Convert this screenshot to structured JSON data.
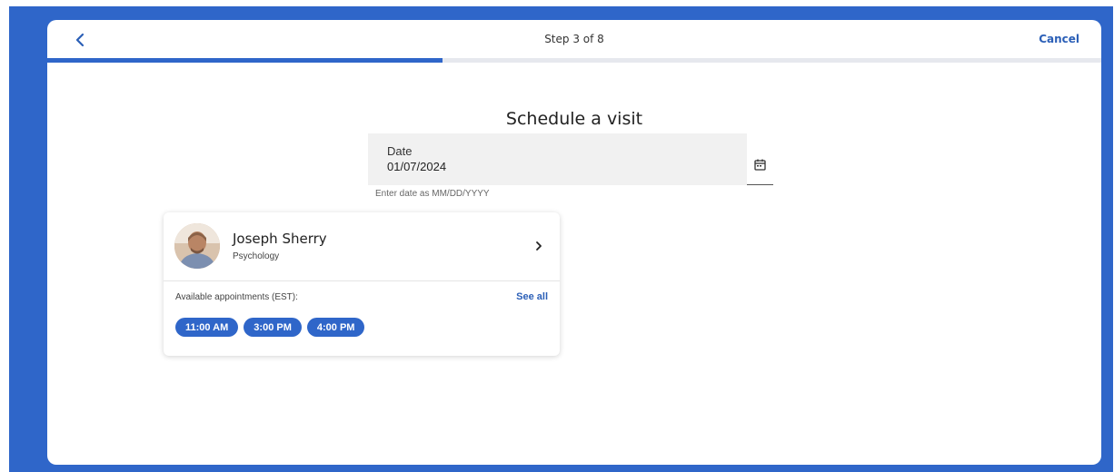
{
  "header": {
    "step_label": "Step 3 of 8",
    "cancel_label": "Cancel",
    "progress_fraction": 0.375
  },
  "page": {
    "title": "Schedule a visit"
  },
  "date_field": {
    "label": "Date",
    "value": "01/07/2024",
    "hint": "Enter date as MM/DD/YYYY"
  },
  "provider": {
    "name": "Joseph Sherry",
    "specialty": "Psychology",
    "available_label": "Available appointments (EST):",
    "see_all_label": "See all",
    "slots": [
      "11:00 AM",
      "3:00 PM",
      "4:00 PM"
    ]
  },
  "colors": {
    "brand_blue": "#2f66c9",
    "link_blue": "#2b5fb7"
  },
  "icons": {
    "back": "chevron-left-icon",
    "calendar": "calendar-icon",
    "provider_nav": "chevron-right-icon"
  }
}
